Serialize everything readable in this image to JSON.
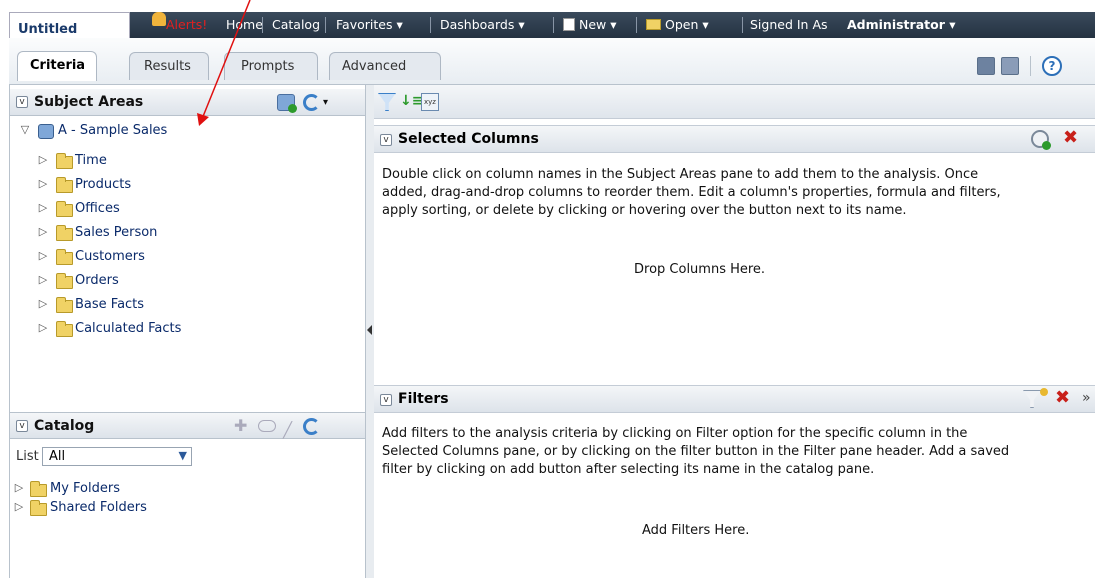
{
  "topbar": {
    "title": "Untitled",
    "alerts": "Alerts!",
    "home": "Home",
    "catalog": "Catalog",
    "favorites": "Favorites",
    "dashboards": "Dashboards",
    "new": "New",
    "open": "Open",
    "signed_in_as": "Signed In As",
    "user": "Administrator",
    "dropdown_glyph": "▾"
  },
  "tabs": [
    {
      "label": "Criteria",
      "active": true
    },
    {
      "label": "Results",
      "active": false
    },
    {
      "label": "Prompts",
      "active": false
    },
    {
      "label": "Advanced",
      "active": false
    }
  ],
  "subject_areas": {
    "title": "Subject Areas",
    "root": "A - Sample Sales",
    "folders": [
      "Time",
      "Products",
      "Offices",
      "Sales Person",
      "Customers",
      "Orders",
      "Base Facts",
      "Calculated Facts"
    ]
  },
  "catalog": {
    "title": "Catalog",
    "list_label": "List",
    "list_value": "All",
    "folders": [
      "My Folders",
      "Shared Folders"
    ]
  },
  "selected_columns": {
    "title": "Selected Columns",
    "description": [
      "Double click on column names in the Subject Areas pane to add them to the analysis. Once",
      "added, drag-and-drop columns to reorder them. Edit a column's properties, formula and filters,",
      "apply sorting, or delete by clicking or hovering over the button next to its name."
    ],
    "drop_message": "Drop Columns Here."
  },
  "filters": {
    "title": "Filters",
    "description": [
      "Add filters to the analysis criteria by clicking on Filter option for the specific column in the",
      "Selected Columns pane, or by clicking on the filter button in the Filter pane header. Add a saved",
      "filter by clicking on add button after selecting its name in the catalog pane."
    ],
    "drop_message": "Add Filters Here.",
    "more_glyph": "»"
  },
  "colors": {
    "topbar": "#2e3d4f",
    "accent_link": "#0a2a6a",
    "alert": "#e02020",
    "annotation_arrow": "#e01010",
    "delete_icon": "#c8201a",
    "add_icon": "#2c9a2c"
  }
}
